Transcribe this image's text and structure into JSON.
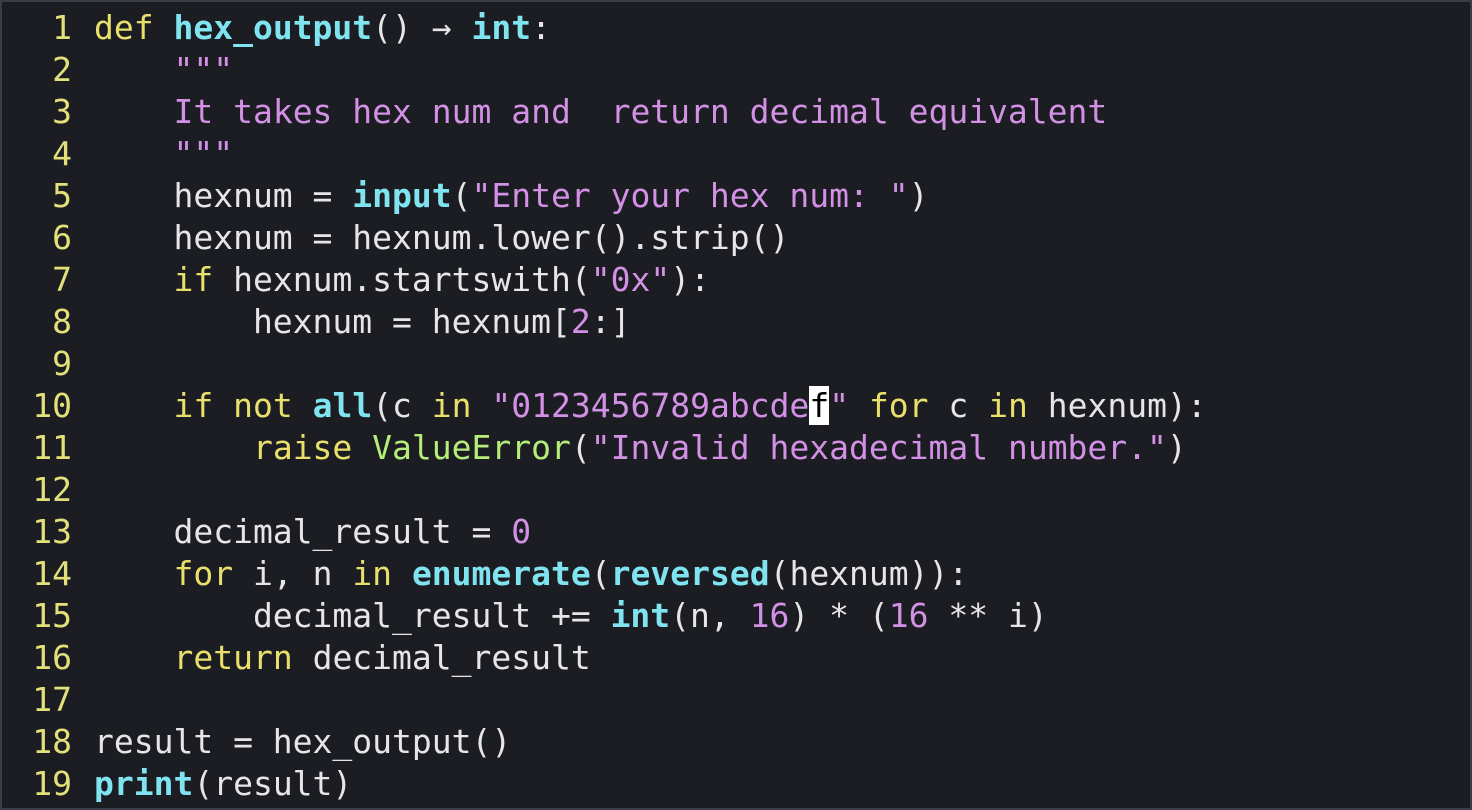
{
  "editor": {
    "language": "python",
    "cursor": {
      "line": 10,
      "char": "f"
    },
    "colors": {
      "background": "#1b1d23",
      "line_number": "#e3e07a",
      "keyword": "#e9e06c",
      "function": "#7fe3f0",
      "class": "#b6ec7a",
      "string": "#d291e4",
      "text": "#e6e6e6"
    },
    "lines": [
      {
        "n": "1",
        "code": [
          [
            "kw",
            "def"
          ],
          [
            "t",
            " "
          ],
          [
            "fn",
            "hex_output"
          ],
          [
            "t",
            "() → "
          ],
          [
            "fn",
            "int"
          ],
          [
            "t",
            ":"
          ]
        ]
      },
      {
        "n": "2",
        "code": [
          [
            "t",
            "    "
          ],
          [
            "str",
            "\"\"\""
          ]
        ]
      },
      {
        "n": "3",
        "code": [
          [
            "t",
            "    "
          ],
          [
            "str",
            "It takes hex num and  return decimal equivalent"
          ]
        ]
      },
      {
        "n": "4",
        "code": [
          [
            "t",
            "    "
          ],
          [
            "str",
            "\"\"\""
          ]
        ]
      },
      {
        "n": "5",
        "code": [
          [
            "t",
            "    hexnum = "
          ],
          [
            "fn",
            "input"
          ],
          [
            "t",
            "("
          ],
          [
            "str",
            "\"Enter your hex num: \""
          ],
          [
            "t",
            ")"
          ]
        ]
      },
      {
        "n": "6",
        "code": [
          [
            "t",
            "    hexnum = hexnum.lower().strip()"
          ]
        ]
      },
      {
        "n": "7",
        "code": [
          [
            "t",
            "    "
          ],
          [
            "kw",
            "if"
          ],
          [
            "t",
            " hexnum.startswith("
          ],
          [
            "str",
            "\"0x\""
          ],
          [
            "t",
            "):"
          ]
        ]
      },
      {
        "n": "8",
        "code": [
          [
            "t",
            "        hexnum = hexnum["
          ],
          [
            "num",
            "2"
          ],
          [
            "t",
            ":]"
          ]
        ]
      },
      {
        "n": "9",
        "code": []
      },
      {
        "n": "10",
        "code": [
          [
            "t",
            "    "
          ],
          [
            "kw",
            "if not"
          ],
          [
            "t",
            " "
          ],
          [
            "fn",
            "all"
          ],
          [
            "t",
            "(c "
          ],
          [
            "kw",
            "in"
          ],
          [
            "t",
            " "
          ],
          [
            "str",
            "\"0123456789abcde"
          ],
          [
            "cursor",
            "f"
          ],
          [
            "str",
            "\""
          ],
          [
            "t",
            " "
          ],
          [
            "kw",
            "for"
          ],
          [
            "t",
            " c "
          ],
          [
            "kw",
            "in"
          ],
          [
            "t",
            " hexnum):"
          ]
        ]
      },
      {
        "n": "11",
        "code": [
          [
            "t",
            "        "
          ],
          [
            "kw",
            "raise"
          ],
          [
            "t",
            " "
          ],
          [
            "cls",
            "ValueError"
          ],
          [
            "t",
            "("
          ],
          [
            "str",
            "\"Invalid hexadecimal number.\""
          ],
          [
            "t",
            ")"
          ]
        ]
      },
      {
        "n": "12",
        "code": []
      },
      {
        "n": "13",
        "code": [
          [
            "t",
            "    decimal_result = "
          ],
          [
            "num",
            "0"
          ]
        ]
      },
      {
        "n": "14",
        "code": [
          [
            "t",
            "    "
          ],
          [
            "kw",
            "for"
          ],
          [
            "t",
            " i, n "
          ],
          [
            "kw",
            "in"
          ],
          [
            "t",
            " "
          ],
          [
            "fn",
            "enumerate"
          ],
          [
            "t",
            "("
          ],
          [
            "fn",
            "reversed"
          ],
          [
            "t",
            "(hexnum)):"
          ]
        ]
      },
      {
        "n": "15",
        "code": [
          [
            "t",
            "        decimal_result += "
          ],
          [
            "fn",
            "int"
          ],
          [
            "t",
            "(n, "
          ],
          [
            "num",
            "16"
          ],
          [
            "t",
            ") * ("
          ],
          [
            "num",
            "16"
          ],
          [
            "t",
            " ** i)"
          ]
        ]
      },
      {
        "n": "16",
        "code": [
          [
            "t",
            "    "
          ],
          [
            "kw",
            "return"
          ],
          [
            "t",
            " decimal_result"
          ]
        ]
      },
      {
        "n": "17",
        "code": []
      },
      {
        "n": "18",
        "code": [
          [
            "t",
            "result = hex_output()"
          ]
        ]
      },
      {
        "n": "19",
        "code": [
          [
            "fn",
            "print"
          ],
          [
            "t",
            "(result)"
          ]
        ]
      }
    ]
  }
}
